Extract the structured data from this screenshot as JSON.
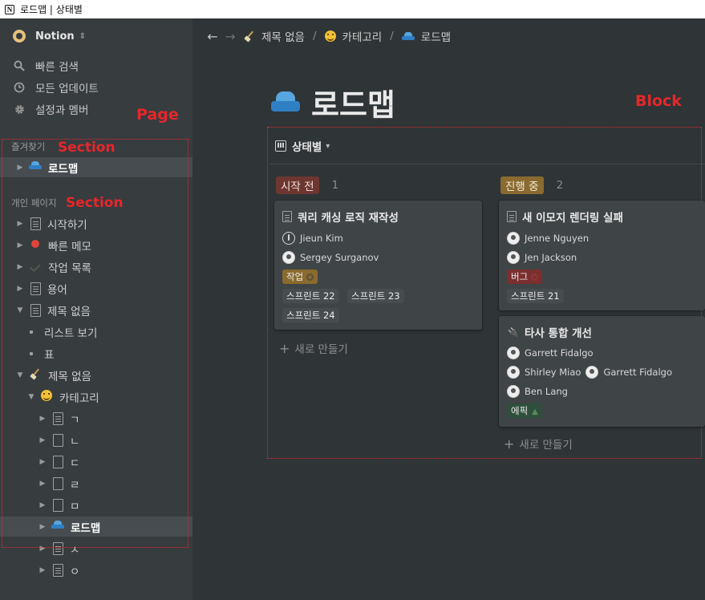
{
  "window": {
    "title": "로드맵 | 상태별",
    "logo": "N"
  },
  "sidebar": {
    "workspace": "Notion",
    "menu": [
      {
        "label": "빠른 검색",
        "icon": "search-icon"
      },
      {
        "label": "모든 업데이트",
        "icon": "clock-icon"
      },
      {
        "label": "설정과 멤버",
        "icon": "gear-icon"
      }
    ],
    "favorites_label": "즐겨찾기",
    "favorites": [
      {
        "label": "로드맵",
        "icon": "car-icon"
      }
    ],
    "private_label": "개인 페이지",
    "tree": [
      {
        "label": "시작하기"
      },
      {
        "label": "빠른 메모"
      },
      {
        "label": "작업 목록"
      },
      {
        "label": "용어"
      },
      {
        "label": "제목 없음"
      },
      {
        "label": "리스트 보기"
      },
      {
        "label": "표"
      },
      {
        "label": "제목 없음"
      },
      {
        "label": "카테고리"
      },
      {
        "label": "ㄱ"
      },
      {
        "label": "ㄴ"
      },
      {
        "label": "ㄷ"
      },
      {
        "label": "ㄹ"
      },
      {
        "label": "ㅁ"
      },
      {
        "label": "로드맵"
      },
      {
        "label": "ㅅ"
      },
      {
        "label": "ㅇ"
      }
    ]
  },
  "breadcrumb": [
    "제목 없음",
    "카테고리",
    "로드맵"
  ],
  "page": {
    "title": "로드맵",
    "view": "상태별"
  },
  "annotations": {
    "page": "Page",
    "block": "Block",
    "section": "Section"
  },
  "board": {
    "columns": [
      {
        "status": "시작 전",
        "count": "1",
        "color": "#6e3630",
        "cards": [
          {
            "title": "쿼리 캐싱 로직 재작성",
            "people": [
              [
                "Jieun Kim"
              ],
              [
                "Sergey Surganov"
              ]
            ],
            "type": "작업",
            "type_color": "#8a6a2e",
            "sprints": [
              "스프린트 22",
              "스프린트 23",
              "스프린트 24"
            ]
          }
        ]
      },
      {
        "status": "진행 중",
        "count": "2",
        "color": "#8a6a2e",
        "cards": [
          {
            "title": "새 이모지 렌더링 실패",
            "people": [
              [
                "Jenne Nguyen"
              ],
              [
                "Jen Jackson"
              ]
            ],
            "type": "버그",
            "type_color": "#7b2f2f",
            "sprints": [
              "스프린트 21"
            ]
          },
          {
            "title": "타사 통합 개선",
            "people": [
              [
                "Garrett Fidalgo"
              ],
              [
                "Shirley Miao",
                "Garrett Fidalgo"
              ],
              [
                "Ben Lang"
              ]
            ],
            "type": "에픽",
            "type_color": "#2f4f3c",
            "sprints": []
          }
        ]
      }
    ],
    "new_label": "새로 만들기"
  }
}
